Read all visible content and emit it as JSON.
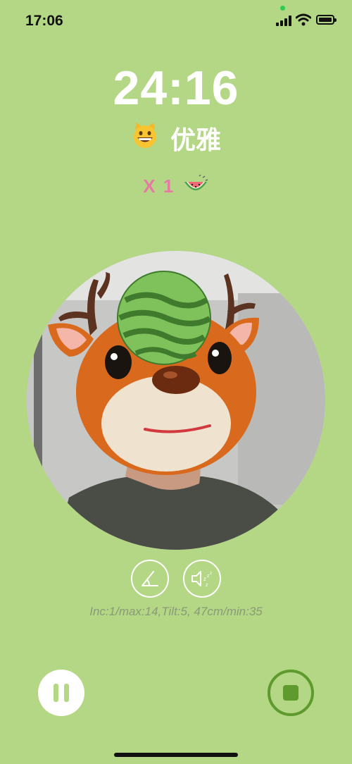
{
  "status_bar": {
    "time": "17:06",
    "icons": [
      "signal-icon",
      "wifi-icon",
      "battery-icon"
    ]
  },
  "session": {
    "timer": "24:16",
    "mood_icon": "grinning-cat-icon",
    "title": "优雅",
    "count_text": "X 1",
    "count_icon": "watermelon-slice-icon"
  },
  "camera": {
    "mask": "deer-mask",
    "hat": "watermelon"
  },
  "controls": {
    "angle_icon": "angle-icon",
    "sound_icon": "sound-off-sleep-icon",
    "info": "Inc:1/max:14,Tilt:5, 47cm/min:35",
    "pause_icon": "pause-icon",
    "stop_icon": "stop-icon"
  },
  "colors": {
    "background": "#b3d785",
    "accent_dark_green": "#5e9a2d",
    "count_pink": "#e57aa2"
  }
}
